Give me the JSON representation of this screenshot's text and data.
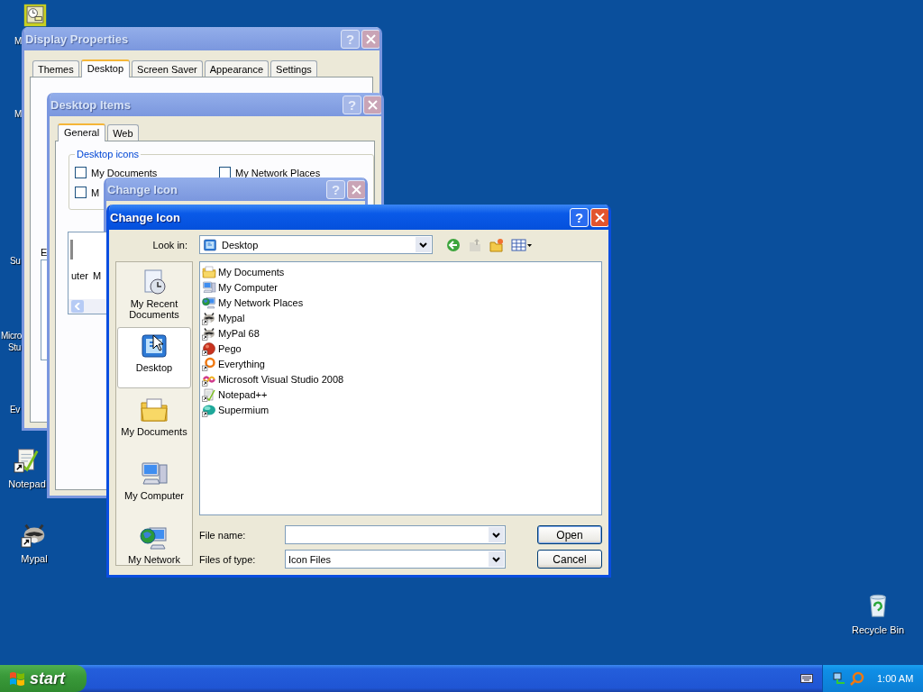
{
  "desktop": {
    "icons": [
      {
        "kind": "display"
      },
      {
        "kind": "notepad",
        "label": "Notepad"
      },
      {
        "kind": "raccoon",
        "label": "Mypal"
      },
      {
        "kind": "recycle",
        "label": "Recycle Bin"
      }
    ],
    "label_fragments": [
      "M",
      "M",
      "Su",
      "Micro",
      "Stu",
      "Ev"
    ]
  },
  "display_properties": {
    "title": "Display Properties",
    "active": false,
    "help": "?",
    "tabs": [
      {
        "label": "Themes",
        "selected": false
      },
      {
        "label": "Desktop",
        "selected": true
      },
      {
        "label": "Screen Saver",
        "selected": false
      },
      {
        "label": "Appearance",
        "selected": false
      },
      {
        "label": "Settings",
        "selected": false
      }
    ],
    "label_fragment": "E"
  },
  "desktop_items": {
    "title": "Desktop Items",
    "active": false,
    "help": "?",
    "tabs": [
      {
        "label": "General",
        "selected": true
      },
      {
        "label": "Web",
        "selected": false
      }
    ],
    "group_title": "Desktop icons",
    "checkboxes": [
      {
        "label": "My Documents",
        "checked": false
      },
      {
        "label": "My Network Places",
        "checked": false
      },
      {
        "label": "M",
        "checked": false
      }
    ],
    "icon_list_fragments": [
      "uter",
      "M"
    ]
  },
  "change_icon_behind": {
    "title": "Change Icon",
    "active": false,
    "help": "?"
  },
  "open_dialog": {
    "title": "Change Icon",
    "active": true,
    "help": "?",
    "look_in": {
      "label": "Look in:",
      "value": "Desktop",
      "kind": "desktop"
    },
    "places": [
      {
        "label": "My Recent Documents",
        "kind": "recent",
        "selected": false
      },
      {
        "label": "Desktop",
        "kind": "desktop",
        "selected": true
      },
      {
        "label": "My Documents",
        "kind": "documents",
        "selected": false
      },
      {
        "label": "My Computer",
        "kind": "computer",
        "selected": false
      },
      {
        "label": "My Network",
        "kind": "network",
        "selected": false
      }
    ],
    "files": [
      {
        "name": "My Documents",
        "kind": "documents",
        "shortcut": false
      },
      {
        "name": "My Computer",
        "kind": "computer",
        "shortcut": false
      },
      {
        "name": "My Network Places",
        "kind": "network",
        "shortcut": false
      },
      {
        "name": "Mypal",
        "kind": "raccoon",
        "shortcut": true
      },
      {
        "name": "MyPal 68",
        "kind": "raccoon",
        "shortcut": true
      },
      {
        "name": "Pego",
        "kind": "pego",
        "shortcut": true
      },
      {
        "name": "Everything",
        "kind": "everything",
        "shortcut": true
      },
      {
        "name": "Microsoft Visual Studio 2008",
        "kind": "vs",
        "shortcut": true
      },
      {
        "name": "Notepad++",
        "kind": "notepad",
        "shortcut": true
      },
      {
        "name": "Supermium",
        "kind": "supermium",
        "shortcut": true
      }
    ],
    "file_name": {
      "label": "File name:"
    },
    "file_type": {
      "label": "Files of type:",
      "value": "Icon Files"
    },
    "buttons": [
      "Open",
      "Cancel"
    ]
  },
  "taskbar": {
    "start": "start",
    "clock": "1:00 AM"
  }
}
